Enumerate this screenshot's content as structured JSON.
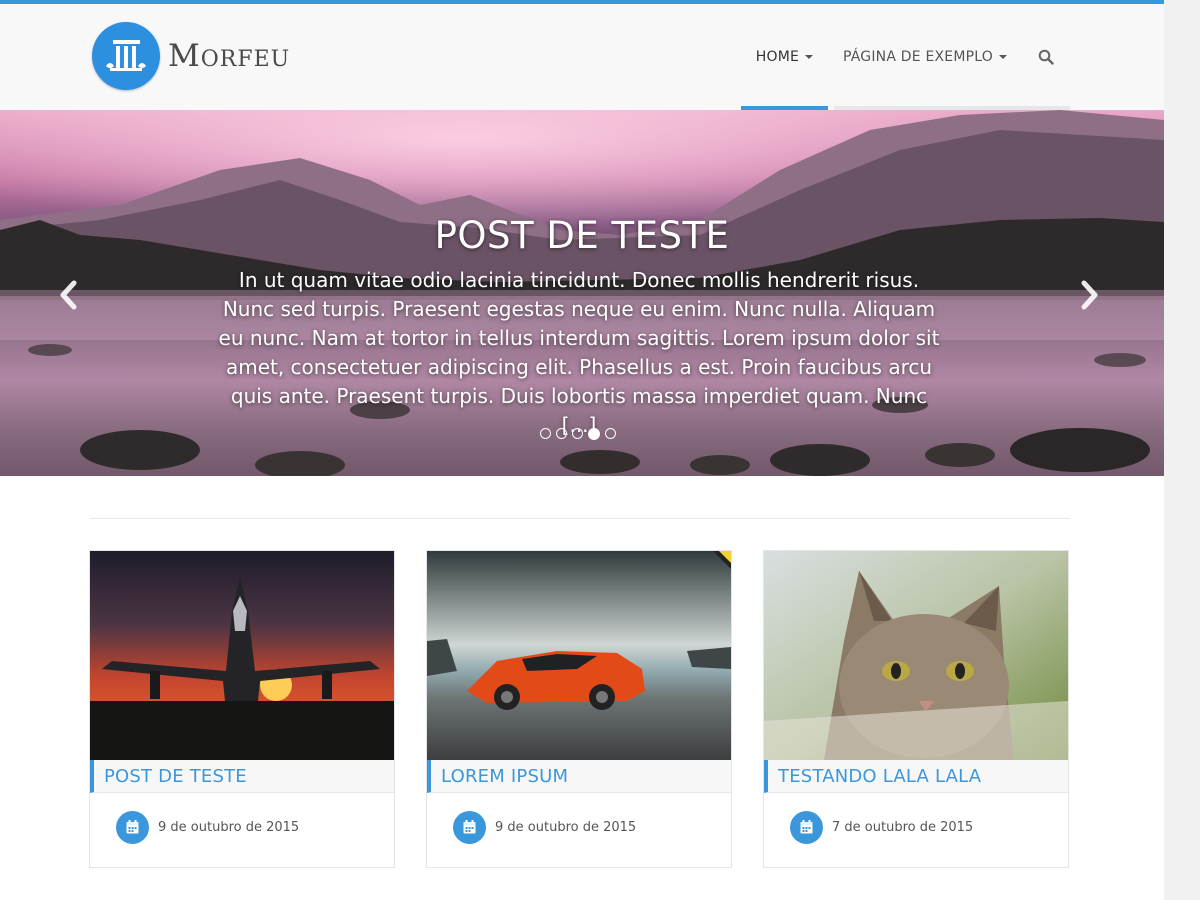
{
  "brand": {
    "name": "Morfeu",
    "accent": "#3a97dc"
  },
  "nav": {
    "items": [
      {
        "label": "HOME",
        "active": true,
        "has_dropdown": true
      },
      {
        "label": "PÁGINA DE EXEMPLO",
        "active": false,
        "has_dropdown": true
      }
    ],
    "search_icon": "search-icon"
  },
  "slider": {
    "title": "POST DE TESTE",
    "excerpt": "In ut quam vitae odio lacinia tincidunt. Donec mollis hendrerit risus. Nunc sed turpis. Praesent egestas neque eu enim. Nunc nulla. Aliquam eu nunc. Nam at tortor in tellus interdum sagittis. Lorem ipsum dolor sit amet, consectetuer adipiscing elit. Phasellus a est. Proin faucibus arcu quis ante. Praesent turpis. Duis lobortis massa imperdiet quam. Nunc [...]",
    "prev_icon": "chevron-left-icon",
    "next_icon": "chevron-right-icon",
    "slide_count": 5,
    "active_slide": 4
  },
  "posts": [
    {
      "title": "POST DE TESTE",
      "date": "9 de outubro de 2015",
      "image": "jet-sunset"
    },
    {
      "title": "LOREM IPSUM",
      "date": "9 de outubro de 2015",
      "image": "orange-sports-car"
    },
    {
      "title": "TESTANDO LALA LALA",
      "date": "7 de outubro de 2015",
      "image": "tabby-cat"
    }
  ]
}
